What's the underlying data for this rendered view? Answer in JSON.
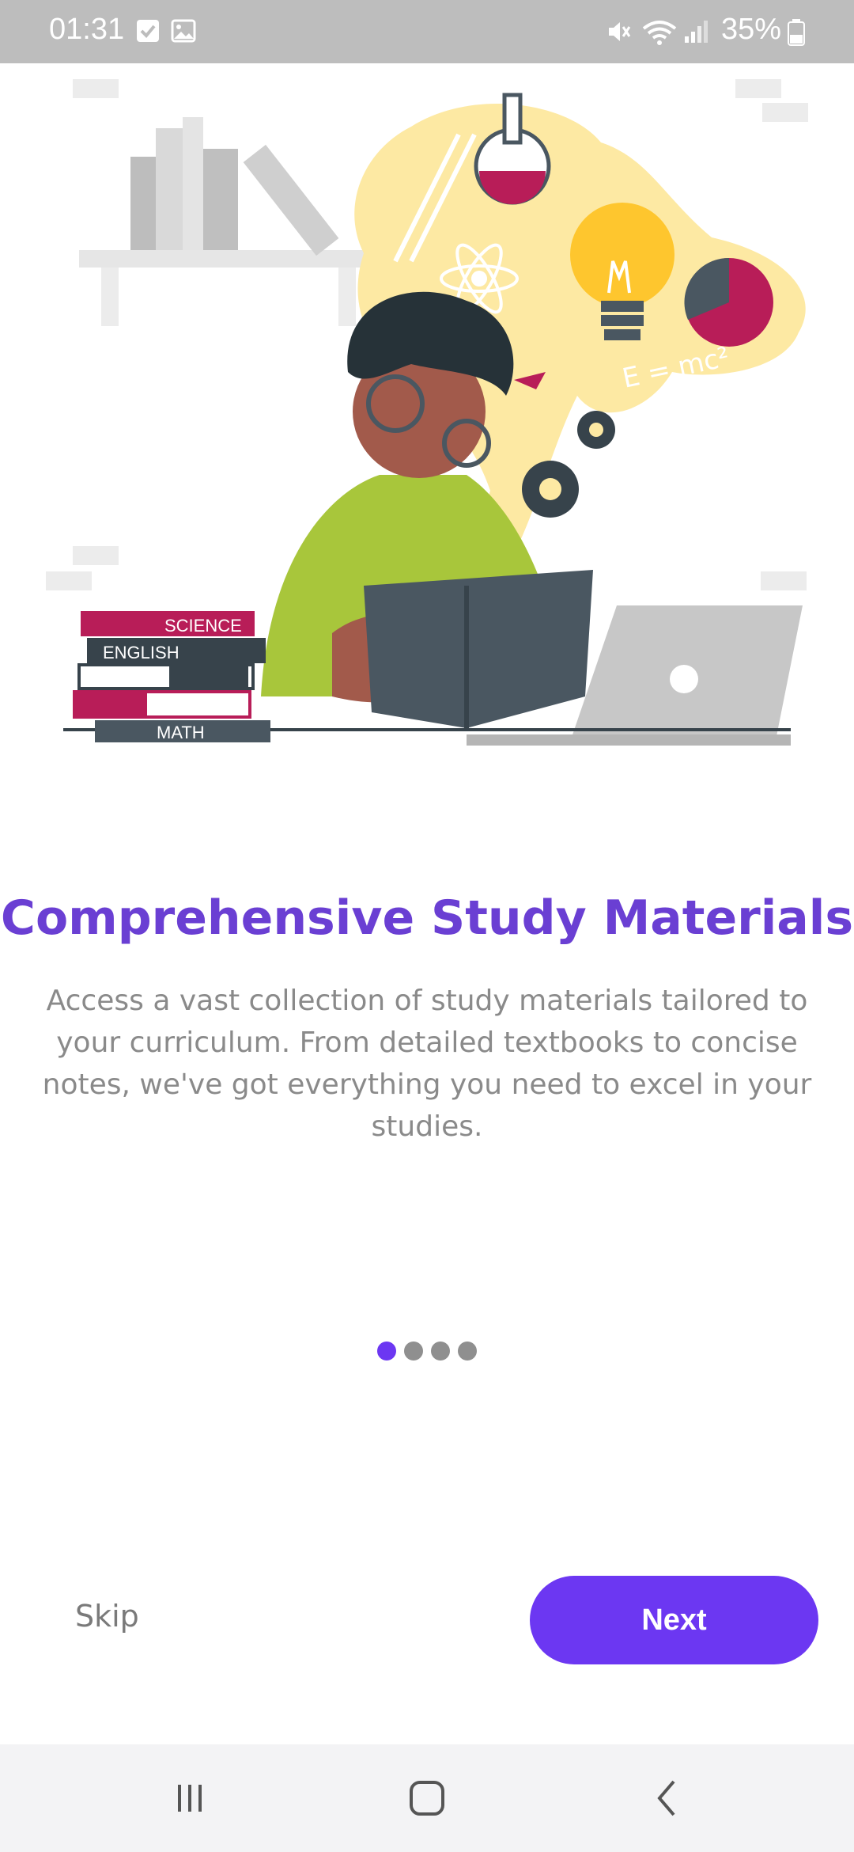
{
  "status_bar": {
    "time": "01:31",
    "battery": "35%",
    "icons": [
      "check-square-icon",
      "image-icon",
      "mute-icon",
      "wifi-icon",
      "signal-icon",
      "battery-icon"
    ]
  },
  "onboarding": {
    "title": "Comprehensive Study Materials",
    "description": "Access a vast collection of study materials tailored to your curriculum. From detailed textbooks to concise notes, we've got everything you need to excel in your studies.",
    "pages": 4,
    "current_page": 1,
    "book_labels": [
      "SCIENCE",
      "ENGLISH",
      "MATH"
    ],
    "formula": "E = mc²",
    "skip_label": "Skip",
    "next_label": "Next"
  },
  "colors": {
    "accent": "#6c37f2",
    "title": "#6a3fd3",
    "dot_active": "#6c37f2",
    "dot_inactive": "#8f8f8f"
  },
  "nav_bar": {
    "buttons": [
      "recent-apps-icon",
      "home-icon",
      "back-icon"
    ]
  }
}
